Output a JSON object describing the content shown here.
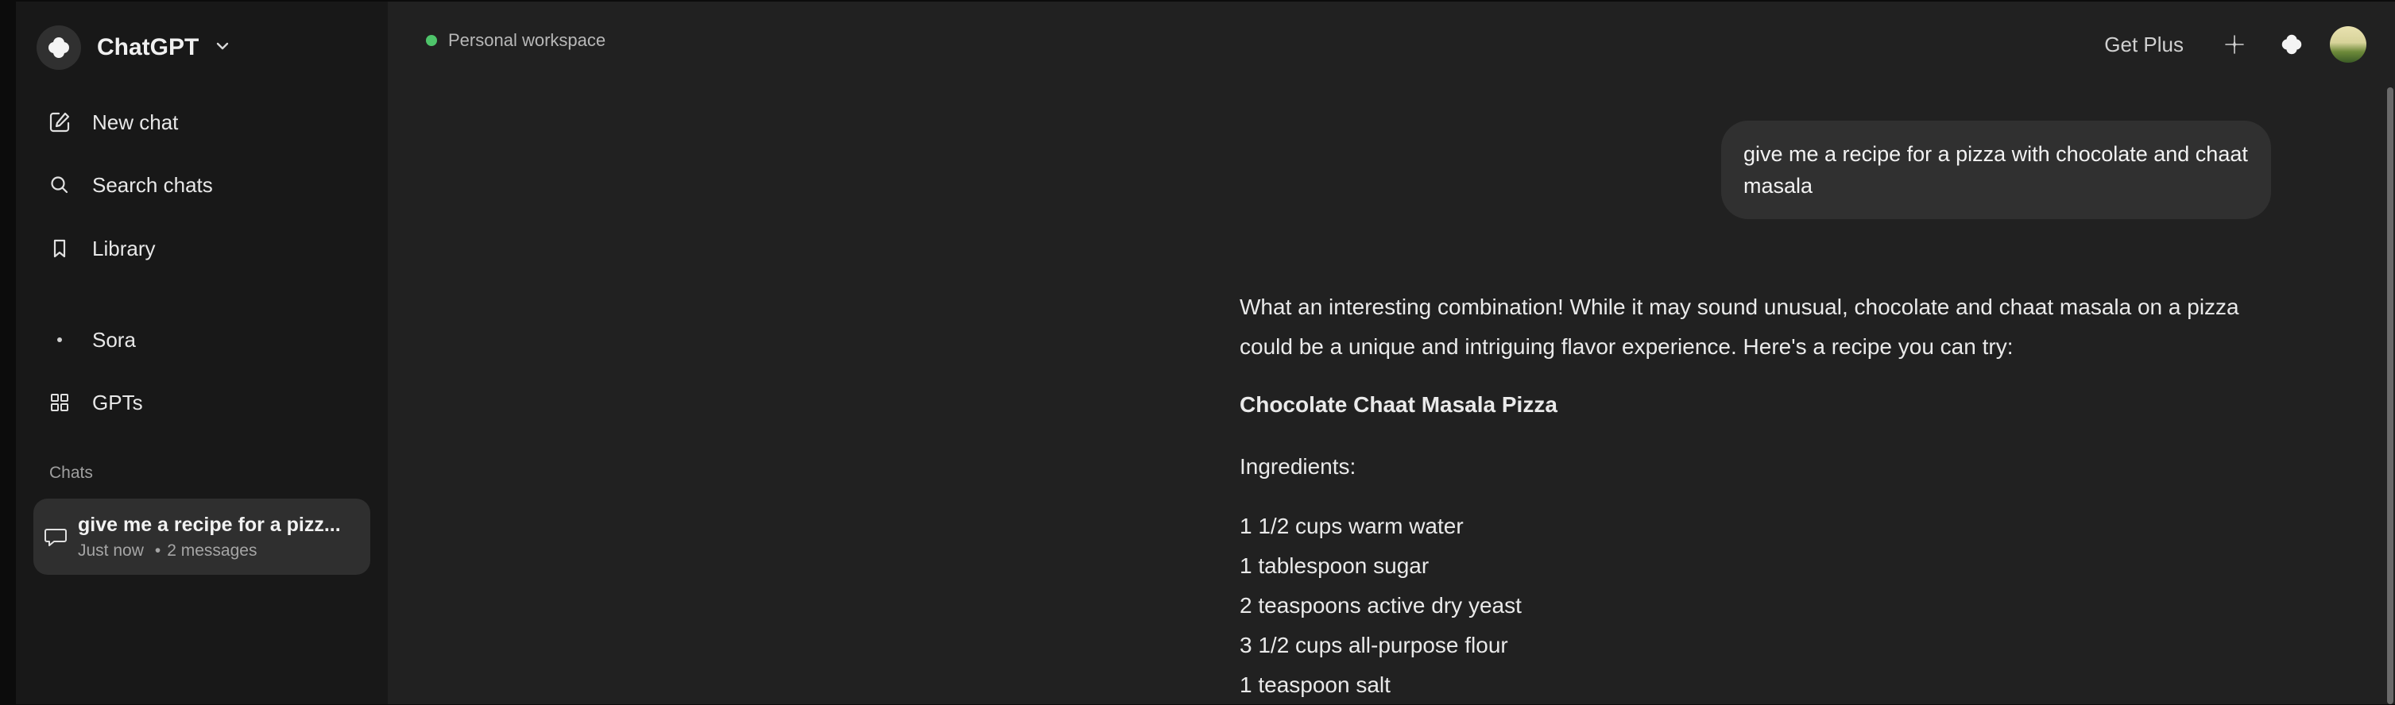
{
  "sidebar": {
    "brand": "ChatGPT",
    "nav": {
      "new_chat": "New chat",
      "search": "Search chats",
      "library": "Library",
      "sora": "Sora",
      "gpts": "GPTs"
    },
    "section_label": "Chats",
    "chats": [
      {
        "title": "give me a recipe for a pizz...",
        "time": "Just now",
        "count": "2 messages"
      }
    ]
  },
  "header": {
    "workspace": "Personal workspace",
    "get_plus": "Get Plus"
  },
  "conversation": {
    "user_message": "give me a recipe for a pizza with chocolate and chaat masala",
    "assistant": {
      "intro_line1": "What an interesting combination! While it may sound unusual, chocolate and chaat masala on a pizza",
      "intro_line2": "could be a unique and intriguing flavor experience. Here's a recipe you can try:",
      "recipe_title": "Chocolate Chaat Masala Pizza",
      "ingredients_heading": "Ingredients:",
      "ingredients": [
        "1 1/2 cups warm water",
        "1 tablespoon sugar",
        "2 teaspoons active dry yeast",
        "3 1/2 cups all-purpose flour",
        "1 teaspoon salt"
      ]
    }
  },
  "colors": {
    "status_dot": "#4ec46a",
    "sidebar_bg": "#181818",
    "main_bg": "#212121",
    "bubble_bg": "#303030"
  }
}
